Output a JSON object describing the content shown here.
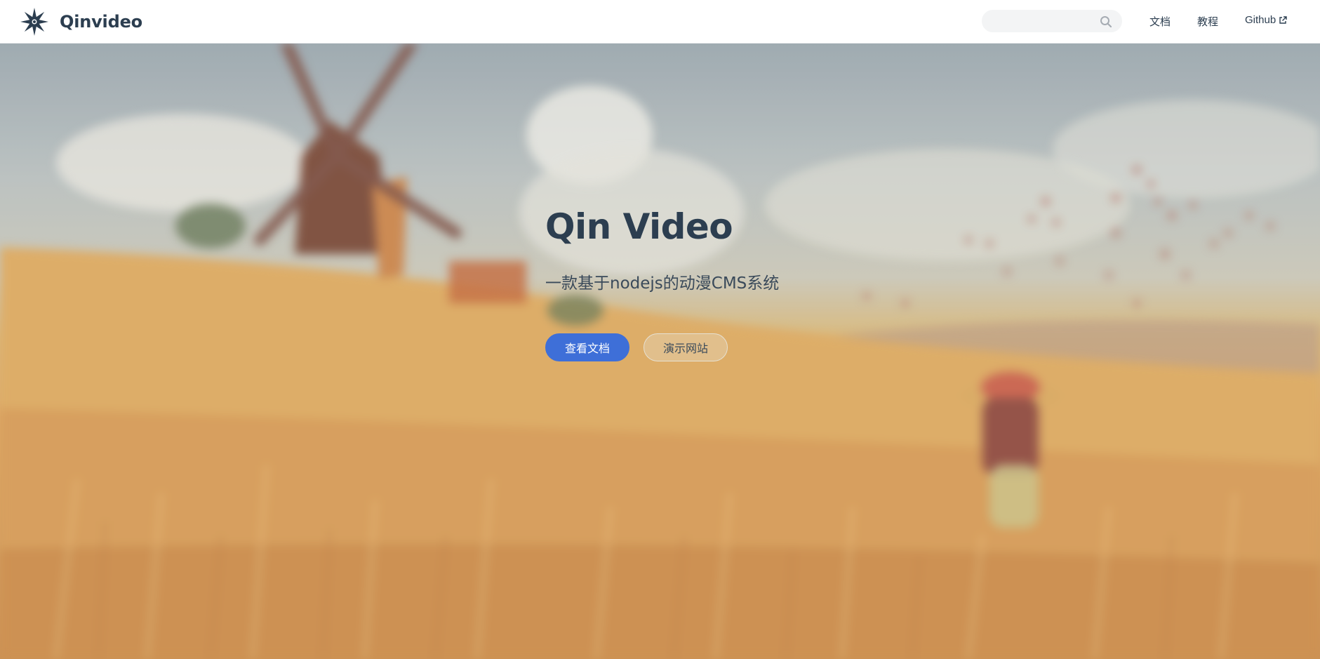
{
  "navbar": {
    "brand_name": "Qinvideo",
    "logo_icon": "star-logo-icon",
    "search": {
      "value": "",
      "placeholder": "",
      "icon": "search-icon"
    },
    "links": [
      {
        "label": "文档"
      },
      {
        "label": "教程"
      },
      {
        "label": "Github",
        "icon": "external-link-icon"
      }
    ]
  },
  "hero": {
    "title": "Qin Video",
    "description": "一款基于nodejs的动漫CMS系统",
    "primary_action": "查看文档",
    "secondary_action": "演示网站",
    "background": "blurred-illustration-windmill-wheat-field-girl"
  },
  "colors": {
    "text": "#2c3e50",
    "accent": "#3e6fd8",
    "navbar_bg": "#ffffff",
    "search_bg": "#f3f4f5"
  }
}
